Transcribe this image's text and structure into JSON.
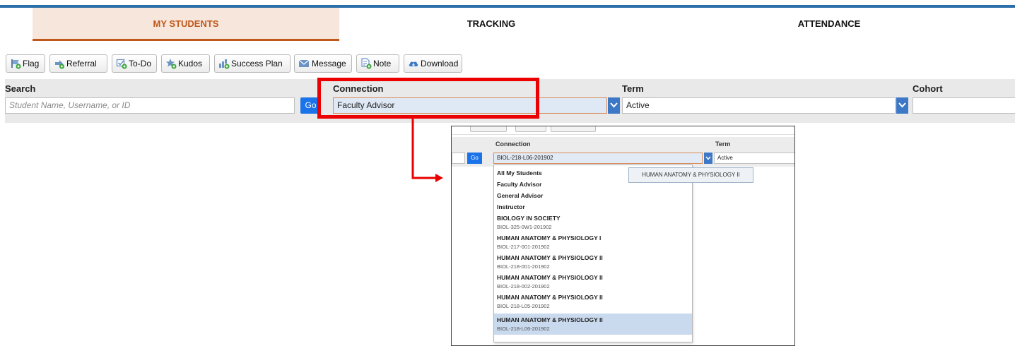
{
  "tabs": [
    {
      "label": "MY STUDENTS",
      "active": true
    },
    {
      "label": "TRACKING",
      "active": false
    },
    {
      "label": "ATTENDANCE",
      "active": false
    }
  ],
  "toolbar": {
    "buttons": [
      {
        "label": "Flag",
        "icon": "flag-icon"
      },
      {
        "label": "Referral",
        "icon": "referral-icon"
      },
      {
        "label": "To-Do",
        "icon": "todo-icon"
      },
      {
        "label": "Kudos",
        "icon": "kudos-star-icon"
      },
      {
        "label": "Success Plan",
        "icon": "success-plan-icon"
      },
      {
        "label": "Message",
        "icon": "envelope-icon"
      },
      {
        "label": "Note",
        "icon": "note-icon"
      },
      {
        "label": "Download",
        "icon": "cloud-download-icon"
      }
    ]
  },
  "filters": {
    "search_label": "Search",
    "search_placeholder": "Student Name, Username, or ID",
    "go_label": "Go",
    "connection_label": "Connection",
    "connection_value": "Faculty Advisor",
    "term_label": "Term",
    "term_value": "Active",
    "cohort_label": "Cohort",
    "cohort_value": ""
  },
  "inset": {
    "connection_label": "Connection",
    "term_label": "Term",
    "go_label": "Go",
    "connection_value": "BIOL-218-L06-201902",
    "term_value": "Active",
    "tooltip": "HUMAN ANATOMY & PHYSIOLOGY II",
    "options": [
      {
        "title": "All My Students"
      },
      {
        "title": "Faculty Advisor"
      },
      {
        "title": "General Advisor"
      },
      {
        "title": "Instructor"
      },
      {
        "title": "BIOLOGY IN SOCIETY",
        "code": "BIOL-325-0W1-201902"
      },
      {
        "title": "HUMAN ANATOMY & PHYSIOLOGY I",
        "code": "BIOL-217-001-201902"
      },
      {
        "title": "HUMAN ANATOMY & PHYSIOLOGY II",
        "code": "BIOL-218-001-201902"
      },
      {
        "title": "HUMAN ANATOMY & PHYSIOLOGY II",
        "code": "BIOL-218-002-201902"
      },
      {
        "title": "HUMAN ANATOMY & PHYSIOLOGY II",
        "code": "BIOL-218-L05-201902"
      },
      {
        "title": "HUMAN ANATOMY & PHYSIOLOGY II",
        "code": "BIOL-218-L06-201902",
        "selected": true
      }
    ]
  },
  "colors": {
    "accent": "#c0571b",
    "tab_active_bg": "#f7e6dc",
    "brand_blue": "#2a6fa8",
    "go_blue": "#1a73e8",
    "highlight_red": "#ea0000"
  }
}
